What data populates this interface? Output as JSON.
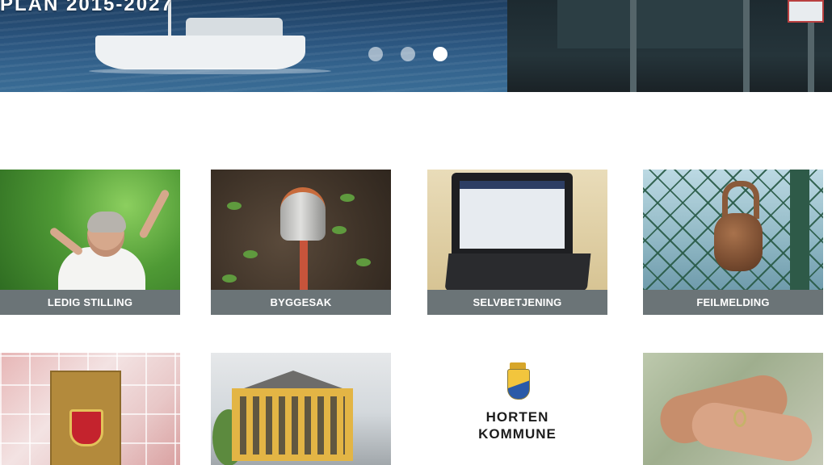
{
  "hero": {
    "title": "PLAN 2015-2027",
    "slides": [
      "slide-1",
      "slide-2",
      "slide-3"
    ],
    "active_slide": 3
  },
  "tiles": [
    {
      "label": "LEDIG STILLING"
    },
    {
      "label": "BYGGESAK"
    },
    {
      "label": "SELVBETJENING"
    },
    {
      "label": "FEILMELDING"
    }
  ],
  "bottom_tiles": {
    "logo": {
      "line1": "HORTEN",
      "line2": "KOMMUNE"
    }
  },
  "colors": {
    "label_bg": "#6b7477",
    "label_text": "#ffffff",
    "dot_active": "#ffffff"
  }
}
